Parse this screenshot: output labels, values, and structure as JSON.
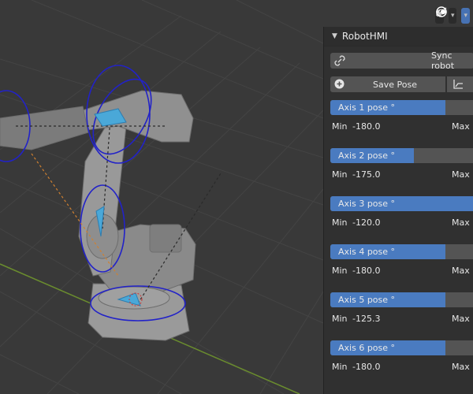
{
  "panel": {
    "title": "RobotHMI",
    "sync_label": "Sync robot",
    "save_pose_label": "Save Pose",
    "axes": [
      {
        "label": "Axis 1 pose °",
        "min_label": "Min",
        "min_value": "-180.0",
        "max_label": "Max",
        "fill": 0.8
      },
      {
        "label": "Axis 2 pose °",
        "min_label": "Min",
        "min_value": "-175.0",
        "max_label": "Max",
        "fill": 0.58
      },
      {
        "label": "Axis 3 pose °",
        "min_label": "Min",
        "min_value": "-120.0",
        "max_label": "Max",
        "fill": 1.0
      },
      {
        "label": "Axis 4 pose °",
        "min_label": "Min",
        "min_value": "-180.0",
        "max_label": "Max",
        "fill": 0.8
      },
      {
        "label": "Axis 5 pose °",
        "min_label": "Min",
        "min_value": "-125.3",
        "max_label": "Max",
        "fill": 0.8
      },
      {
        "label": "Axis 6 pose °",
        "min_label": "Min",
        "min_value": "-180.0",
        "max_label": "Max",
        "fill": 0.8
      }
    ]
  },
  "header_icons": [
    "eye-icon",
    "gizmo-icon",
    "overlay-icon"
  ],
  "colors": {
    "accent": "#4a7bc0",
    "panel": "#303030",
    "viewport": "#393939",
    "grid_x": "#8c3d3d",
    "grid_y": "#6a8c2e"
  }
}
